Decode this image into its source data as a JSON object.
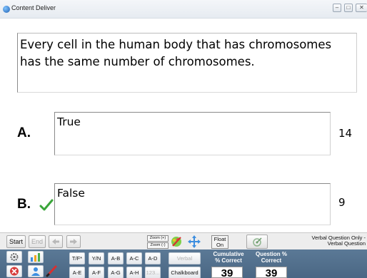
{
  "window": {
    "title": "Content Deliver"
  },
  "question": {
    "text": "Every cell in the human body that has chromosomes has the same number of chromosomes."
  },
  "answers": [
    {
      "letter": "A.",
      "text": "True",
      "count": "14",
      "correct": false
    },
    {
      "letter": "B.",
      "text": "False",
      "count": "9",
      "correct": true
    }
  ],
  "toolbar": {
    "start": "Start",
    "end": "End",
    "zoom_in": "Zoom (+)",
    "zoom_out": "Zoom (-)",
    "float_line1": "Float",
    "float_line2": "On",
    "verbal_line1": "Verbal Question Only -",
    "verbal_line2": "Verbal Question"
  },
  "toolbar2": {
    "row1": [
      "T/F*",
      "Y/N",
      "A-B",
      "A-C",
      "A-D"
    ],
    "row2": [
      "A-E",
      "A-F",
      "A-G",
      "A-H",
      "123..."
    ],
    "verbal": "Verbal",
    "chalkboard": "Chalkboard"
  },
  "stats": {
    "cumulative_label_1": "Cumulative",
    "cumulative_label_2": "% Correct",
    "cumulative_value": "39",
    "question_label_1": "Question %",
    "question_label_2": "Correct",
    "question_value": "39"
  },
  "colors": {
    "check": "#3aa53a",
    "toolbar_dark": "#56738f"
  }
}
